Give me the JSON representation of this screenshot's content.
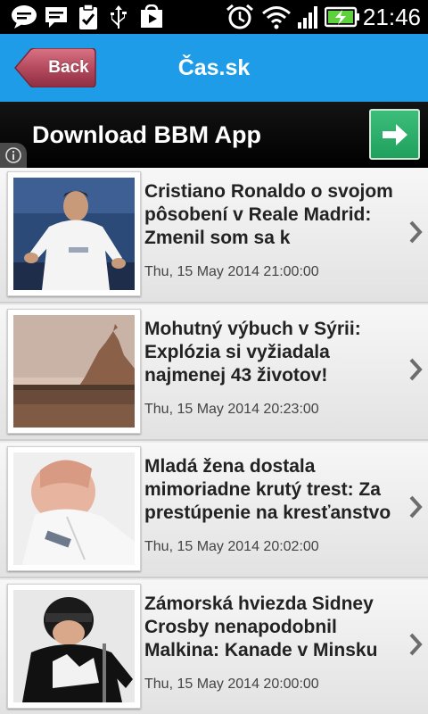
{
  "status_bar": {
    "time": "21:46",
    "icons": [
      "chat-bubble-icon",
      "message-icon",
      "clipboard-check-icon",
      "usb-icon",
      "play-store-icon",
      "alarm-icon",
      "wifi-icon",
      "signal-icon",
      "battery-charging-icon"
    ]
  },
  "nav": {
    "back_label": "Back",
    "title": "Čas.sk",
    "accent_color": "#1e9ce8",
    "back_color": "#b54a5e"
  },
  "banner": {
    "text": "Download BBM App",
    "button_icon": "arrow-right-icon",
    "info_icon": "info-icon",
    "button_color": "#2aa865"
  },
  "news": [
    {
      "title": "Cristiano Ronaldo o svojom pôsobení v Reale Madrid: Zmenil som sa k",
      "date": "Thu, 15 May 2014 21:00:00",
      "thumbnail": "football-player-photo"
    },
    {
      "title": "Mohutný výbuch v Sýrii: Explózia si vyžiadala najmenej 43 životov!",
      "date": "Thu, 15 May 2014 20:23:00",
      "thumbnail": "desert-landscape-photo"
    },
    {
      "title": "Mladá žena dostala mimoriadne krutý trest: Za prestúpenie na kresťanstvo",
      "date": "Thu, 15 May 2014 20:02:00",
      "thumbnail": "crying-woman-photo"
    },
    {
      "title": "Zámorská hviezda Sidney Crosby nenapodobnil Malkina: Kanade v Minsku",
      "date": "Thu, 15 May 2014 20:00:00",
      "thumbnail": "hockey-player-photo"
    }
  ]
}
